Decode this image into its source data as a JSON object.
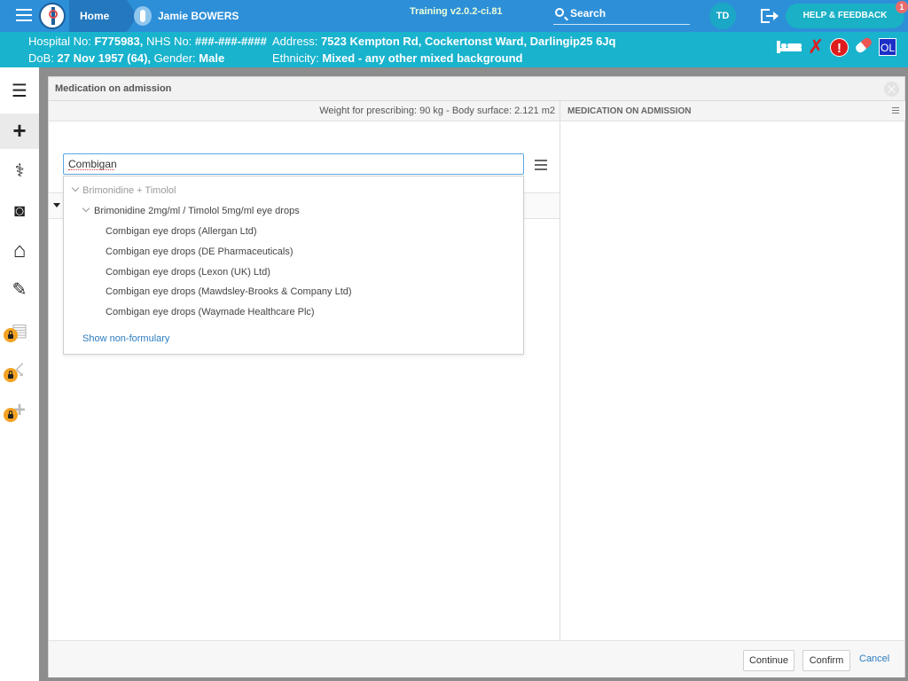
{
  "topbar": {
    "home_label": "Home",
    "patient_name": "Jamie BOWERS",
    "version": "Training v2.0.2-ci.81",
    "search_label": "Search",
    "user_initials": "TD",
    "help_label": "HELP & FEEDBACK",
    "help_badge": "1"
  },
  "banner": {
    "hospital_label": "Hospital No:",
    "hospital_no": "F775983,",
    "nhs_label": "NHS No:",
    "nhs_no": "###-###-####",
    "address_label": "Address:",
    "address": "7523 Kempton Rd, Cockertonst Ward, Darlingip25 6Jq",
    "dob_label": "DoB:",
    "dob": "27 Nov 1957 (64),",
    "gender_label": "Gender:",
    "gender": "Male",
    "ethnicity_label": "Ethnicity:",
    "ethnicity": "Mixed - any other mixed background",
    "icons": [
      "bed-icon",
      "red-x-icon",
      "alert-icon",
      "pill-icon",
      "ol-badge"
    ],
    "ol_label": "OL"
  },
  "sidebar": {
    "items": [
      {
        "icon": "list-icon",
        "glyph": "☰"
      },
      {
        "icon": "plus-icon",
        "glyph": "+"
      },
      {
        "icon": "stethoscope-icon",
        "glyph": "⚕"
      },
      {
        "icon": "camera-icon",
        "glyph": "◙"
      },
      {
        "icon": "home-icon",
        "glyph": "⌂"
      },
      {
        "icon": "sign-doc-icon",
        "glyph": "✎"
      },
      {
        "icon": "clipboard-locked-icon",
        "glyph": "▤"
      },
      {
        "icon": "walking-locked-icon",
        "glyph": "☇"
      },
      {
        "icon": "plus-locked-icon",
        "glyph": "+"
      }
    ]
  },
  "modal": {
    "title": "Medication on admission",
    "weight_text": "Weight for prescribing: 90 kg - Body surface: 2.121 m2",
    "right_title": "MEDICATION ON ADMISSION",
    "search_value": "Combigan",
    "results": {
      "group": "Brimonidine + Timolol",
      "subgroup": "Brimonidine 2mg/ml / Timolol 5mg/ml eye drops",
      "items": [
        "Combigan eye drops (Allergan Ltd)",
        "Combigan eye drops (DE Pharmaceuticals)",
        "Combigan eye drops (Lexon (UK) Ltd)",
        "Combigan eye drops (Mawdsley-Brooks & Company Ltd)",
        "Combigan eye drops (Waymade Healthcare Plc)"
      ],
      "show_more": "Show non-formulary"
    },
    "footer": {
      "continue_label": "Continue",
      "confirm_label": "Confirm",
      "cancel_label": "Cancel"
    }
  },
  "colors": {
    "topbar": "#2d8fd8",
    "banner": "#19b3cd",
    "accent_link": "#2b7bbf",
    "lock": "#f3a223"
  }
}
